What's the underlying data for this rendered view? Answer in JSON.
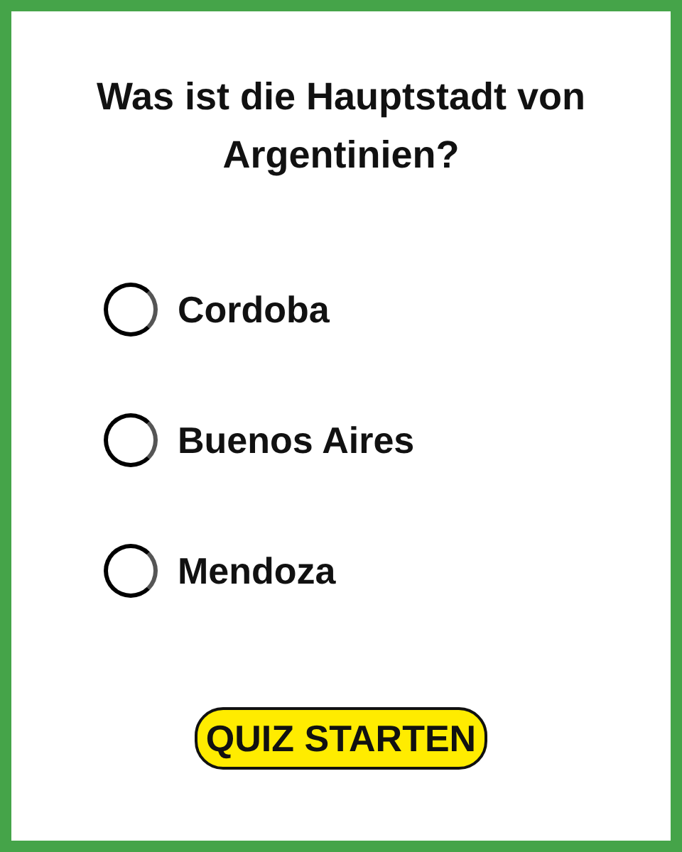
{
  "question": "Was ist die Hauptstadt von Argentinien?",
  "options": [
    {
      "label": "Cordoba",
      "selected": false
    },
    {
      "label": "Buenos Aires",
      "selected": false
    },
    {
      "label": "Mendoza",
      "selected": false
    }
  ],
  "button": "QUIZ STARTEN"
}
